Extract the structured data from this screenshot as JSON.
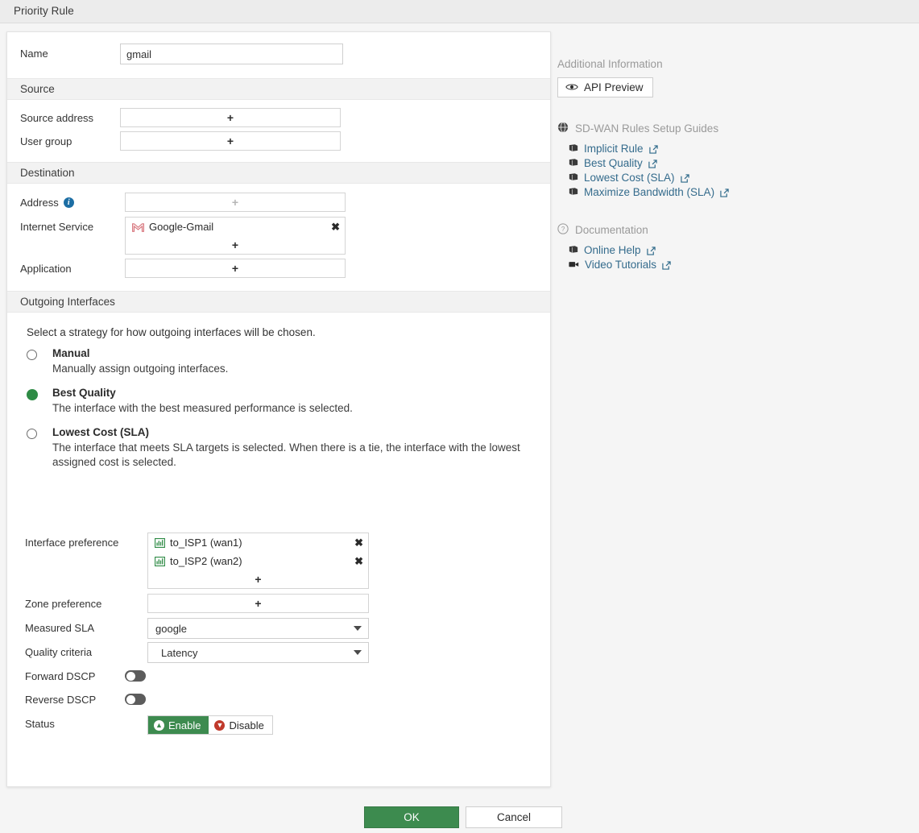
{
  "window": {
    "title": "Priority Rule"
  },
  "form": {
    "name": {
      "label": "Name",
      "value": "gmail"
    },
    "sections": {
      "source": {
        "title": "Source",
        "source_address": {
          "label": "Source address",
          "add": "+"
        },
        "user_group": {
          "label": "User group",
          "add": "+"
        }
      },
      "destination": {
        "title": "Destination",
        "address": {
          "label": "Address",
          "info_icon": "info-icon",
          "add": "+"
        },
        "internet_service": {
          "label": "Internet Service",
          "items": [
            {
              "name": "Google-Gmail",
              "icon": "gmail-icon",
              "remove": "✖"
            }
          ],
          "add": "+"
        },
        "application": {
          "label": "Application",
          "add": "+"
        }
      },
      "outgoing": {
        "title": "Outgoing Interfaces",
        "intro": "Select a strategy for how outgoing interfaces will be chosen.",
        "strategies": [
          {
            "title": "Manual",
            "desc": "Manually assign outgoing interfaces.",
            "selected": false
          },
          {
            "title": "Best Quality",
            "desc": "The interface with the best measured performance is selected.",
            "selected": true
          },
          {
            "title": "Lowest Cost (SLA)",
            "desc": "The interface that meets SLA targets is selected. When there is a tie, the interface with the lowest assigned cost is selected.",
            "selected": false
          }
        ],
        "interface_preference": {
          "label": "Interface preference",
          "items": [
            {
              "name": "to_ISP1 (wan1)",
              "icon": "interface-icon",
              "remove": "✖"
            },
            {
              "name": "to_ISP2 (wan2)",
              "icon": "interface-icon",
              "remove": "✖"
            }
          ],
          "add": "+"
        },
        "zone_preference": {
          "label": "Zone preference",
          "add": "+"
        },
        "measured_sla": {
          "label": "Measured SLA",
          "value": "google"
        },
        "quality_criteria": {
          "label": "Quality criteria",
          "value": "Latency"
        },
        "forward_dscp": {
          "label": "Forward DSCP",
          "on": false
        },
        "reverse_dscp": {
          "label": "Reverse DSCP",
          "on": false
        },
        "status": {
          "label": "Status",
          "enable": "Enable",
          "disable": "Disable",
          "selected": "Enable"
        }
      }
    }
  },
  "aside": {
    "heading": "Additional Information",
    "api_preview": {
      "label": "API Preview",
      "icon": "eye-icon"
    },
    "groups": [
      {
        "title": "SD-WAN Rules Setup Guides",
        "icon": "globe-icon",
        "links": [
          {
            "label": "Implicit Rule",
            "icon": "book-icon"
          },
          {
            "label": "Best Quality",
            "icon": "book-icon"
          },
          {
            "label": "Lowest Cost (SLA)",
            "icon": "book-icon"
          },
          {
            "label": "Maximize Bandwidth (SLA)",
            "icon": "book-icon"
          }
        ]
      },
      {
        "title": "Documentation",
        "icon": "question-icon",
        "links": [
          {
            "label": "Online Help",
            "icon": "book-icon"
          },
          {
            "label": "Video Tutorials",
            "icon": "video-icon"
          }
        ]
      }
    ]
  },
  "footer": {
    "ok": "OK",
    "cancel": "Cancel"
  },
  "colors": {
    "accent_green": "#3d8b4f",
    "link_blue": "#346b8c",
    "info_blue": "#1c6ea4",
    "danger_red": "#c0392b",
    "gmail_red": "#d97b82"
  }
}
